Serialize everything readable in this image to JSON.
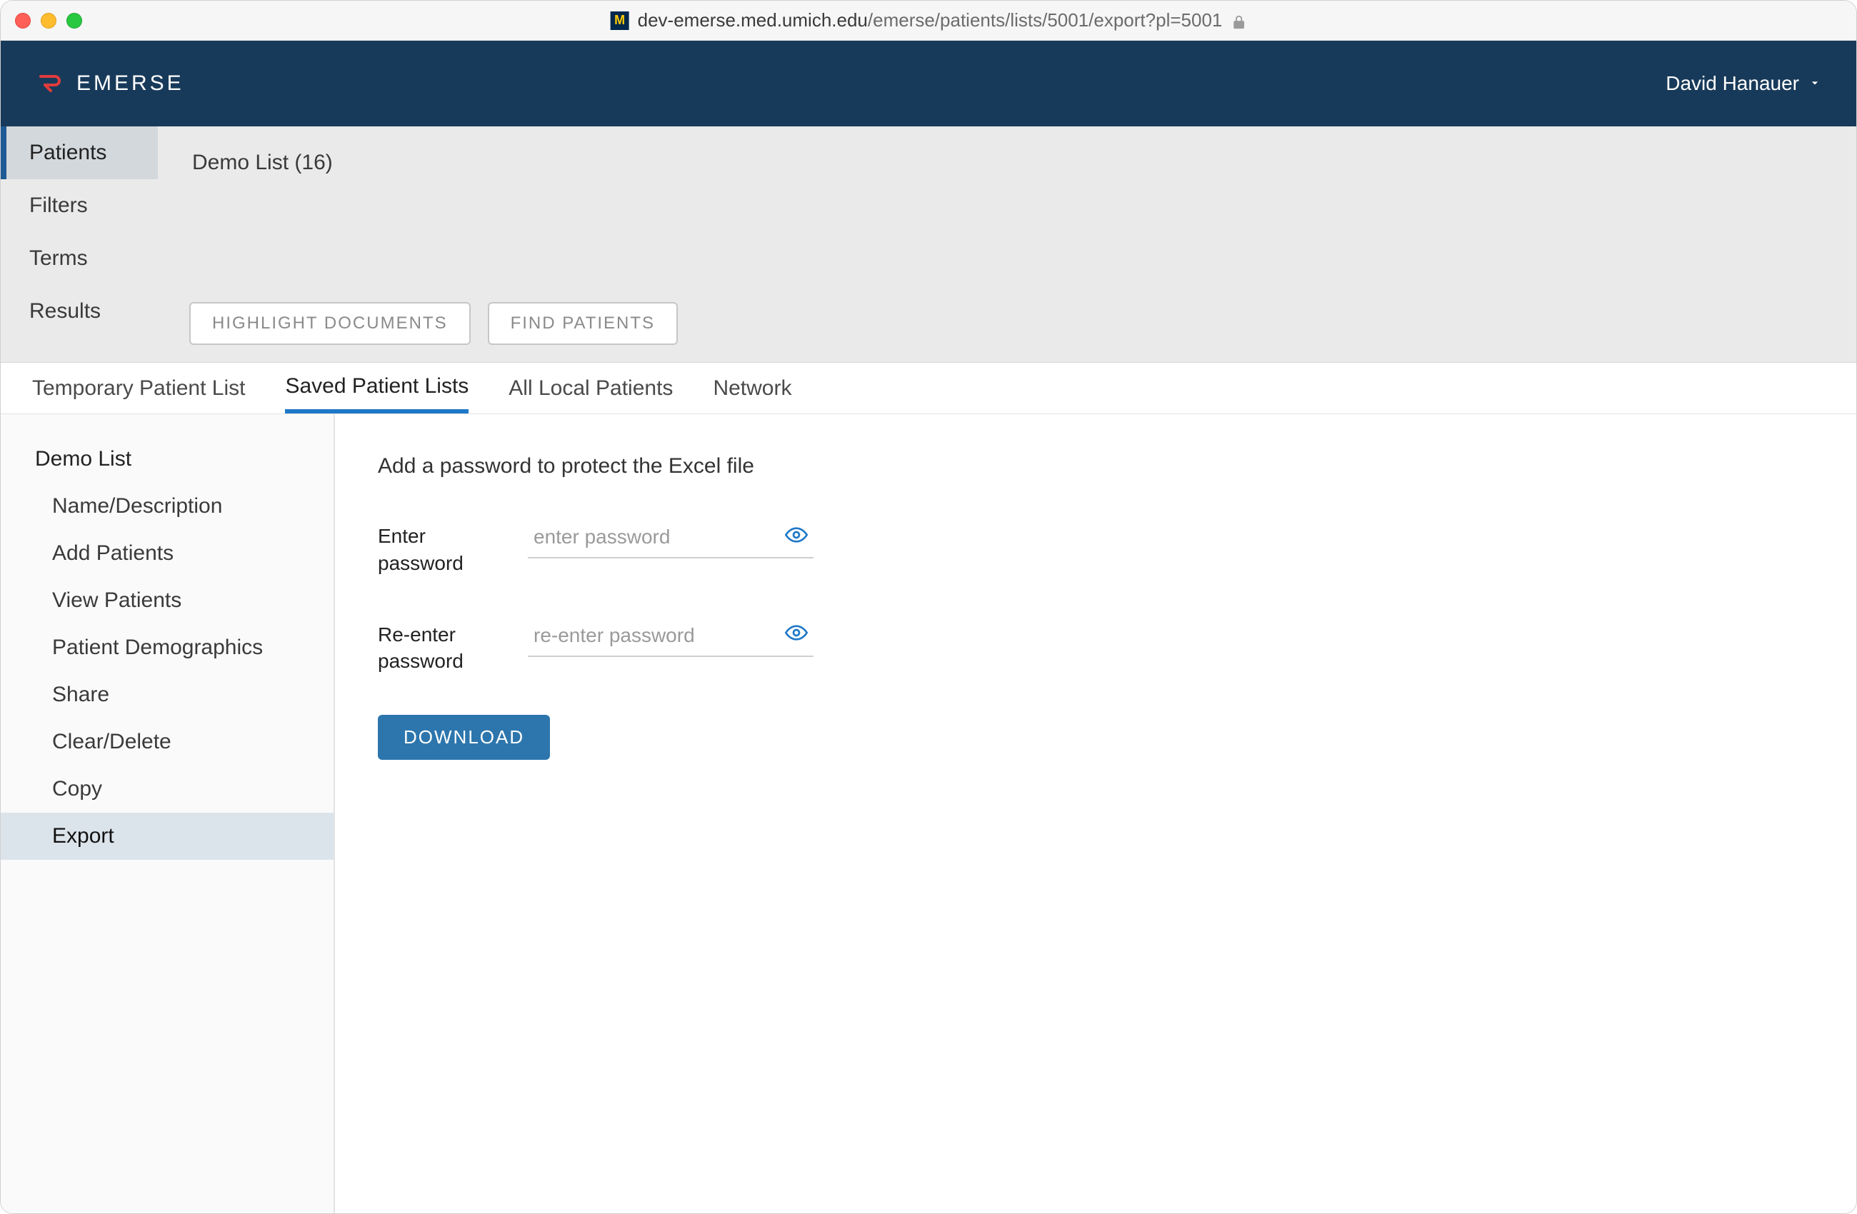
{
  "titlebar": {
    "url_domain": "dev-emerse.med.umich.edu",
    "url_path": "/emerse/patients/lists/5001/export?pl=5001",
    "favicon_letter": "M"
  },
  "header": {
    "brand": "EMERSE",
    "user_name": "David Hanauer"
  },
  "leftnav": {
    "items": [
      "Patients",
      "Filters",
      "Terms",
      "Results"
    ],
    "active_index": 0
  },
  "breadcrumb": {
    "list_name": "Demo List",
    "count_label": "(16)"
  },
  "action_buttons": {
    "highlight": "HIGHLIGHT DOCUMENTS",
    "find": "FIND PATIENTS"
  },
  "subtabs": {
    "items": [
      "Temporary Patient List",
      "Saved Patient Lists",
      "All Local Patients",
      "Network"
    ],
    "active_index": 1
  },
  "sidepanel": {
    "title": "Demo List",
    "items": [
      "Name/Description",
      "Add Patients",
      "View Patients",
      "Patient Demographics",
      "Share",
      "Clear/Delete",
      "Copy",
      "Export"
    ],
    "active_index": 7
  },
  "export_form": {
    "heading": "Add a password to protect the Excel file",
    "enter_label": "Enter password",
    "enter_placeholder": "enter password",
    "reenter_label": "Re-enter password",
    "reenter_placeholder": "re-enter password",
    "download_label": "DOWNLOAD"
  }
}
